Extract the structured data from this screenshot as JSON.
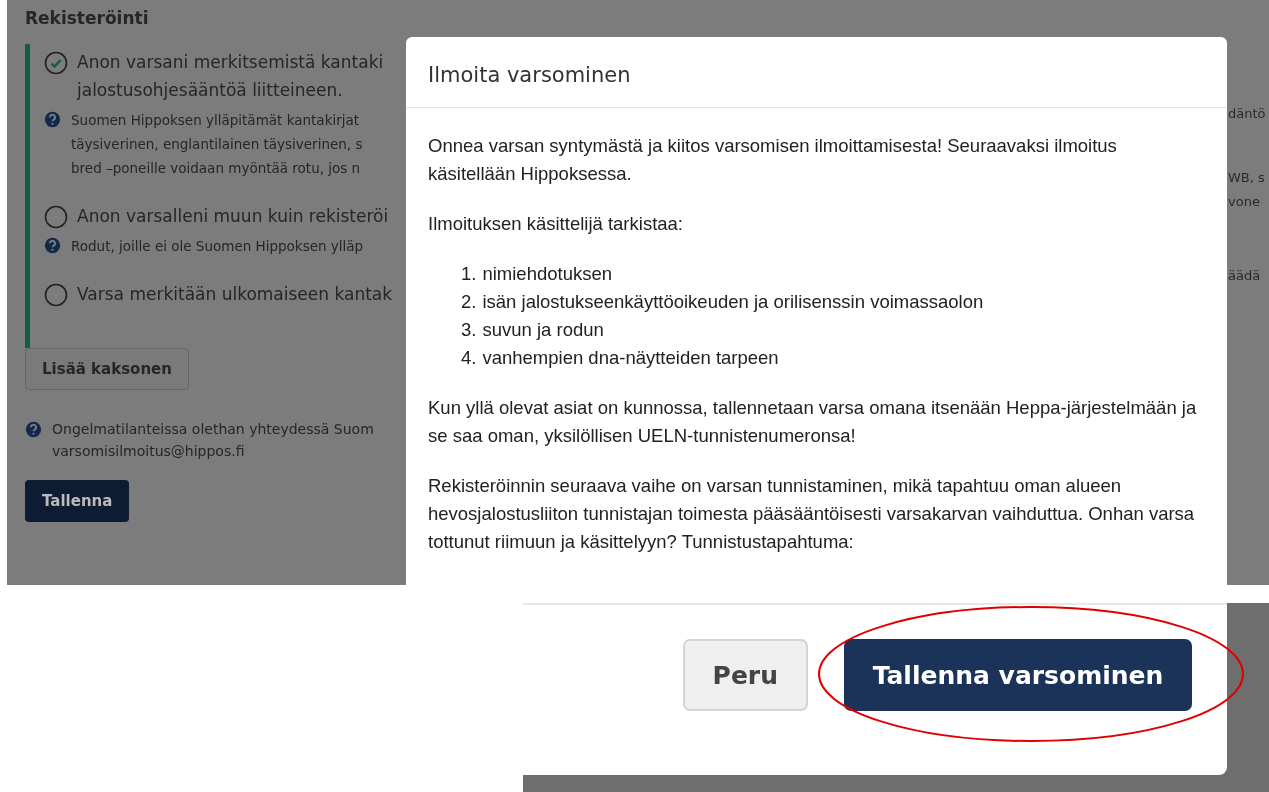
{
  "page": {
    "heading": "Rekisteröinti",
    "options": [
      {
        "selected": true,
        "lines": [
          "Anon varsani merkitsemistä kantaki",
          "jalostusohjesääntöä liitteineen."
        ],
        "help_lines": [
          "Suomen Hippoksen ylläpitämät kantakirjat",
          "täysiverinen, englantilainen täysiverinen, s",
          "bred –poneille voidaan myöntää rotu, jos n"
        ]
      },
      {
        "selected": false,
        "lines": [
          "Anon varsalleni muun kuin rekisteröi"
        ],
        "help_lines": [
          "Rodut, joille ei ole Suomen Hippoksen ylläp"
        ]
      },
      {
        "selected": false,
        "lines": [
          "Varsa merkitään ulkomaiseen kantak"
        ]
      }
    ],
    "add_twin_button": "Lisää kaksonen",
    "help_note": [
      "Ongelmatilanteissa olethan yhteydessä Suom",
      "varsomisilmoitus@hippos.fi"
    ],
    "save_button": "Tallenna",
    "right_edge_texts": [
      "däntö",
      "WB, s",
      "vone",
      "äädä"
    ]
  },
  "dialog": {
    "title": "Ilmoita varsominen",
    "blocks": [
      {
        "kind": "paragraph",
        "text": "Onnea varsan syntymästä ja kiitos varsomisen ilmoittamisesta! Seuraavaksi ilmoitus käsitellään Hippoksessa."
      },
      {
        "kind": "paragraph",
        "text": "Ilmoituksen käsittelijä tarkistaa:"
      },
      {
        "kind": "list",
        "items": [
          {
            "number": "1.",
            "text": "nimiehdotuksen"
          },
          {
            "number": "2.",
            "text": "isän jalostukseenkäyttöoikeuden ja orilisenssin voimassaolon"
          },
          {
            "number": "3.",
            "text": "suvun ja rodun"
          },
          {
            "number": "4.",
            "text": "vanhempien dna-näytteiden tarpeen"
          }
        ]
      },
      {
        "kind": "paragraph",
        "text": "Kun yllä olevat asiat on kunnossa, tallennetaan varsa omana itsenään Heppa-järjestelmään ja se saa oman, yksilöllisen UELN-tunnistenumeronsa!"
      },
      {
        "kind": "paragraph",
        "text": "Rekisteröinnin seuraava vaihe on varsan tunnistaminen, mikä tapahtuu oman alueen hevosjalostusliiton tunnistajan toimesta pääsääntöisesti varsakarvan vaihduttua. Onhan varsa tottunut riimuun ja käsittelyyn? Tunnistustapahtuma:"
      }
    ]
  },
  "zoomed_footer": {
    "buttons": [
      {
        "kind": "secondary",
        "label": "Peru"
      },
      {
        "kind": "primary",
        "label": "Tallenna varsominen"
      }
    ]
  }
}
